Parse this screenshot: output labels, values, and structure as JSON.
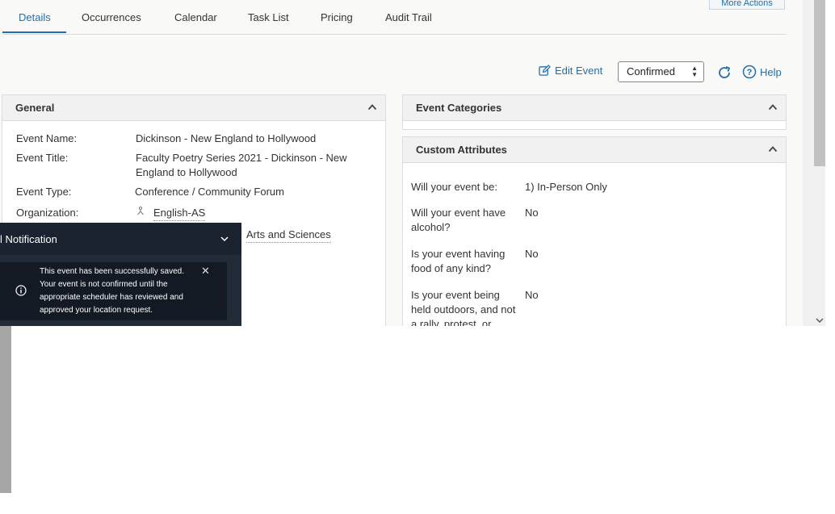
{
  "tabs": [
    {
      "label": "Details",
      "active": true
    },
    {
      "label": "Occurrences"
    },
    {
      "label": "Calendar"
    },
    {
      "label": "Task List"
    },
    {
      "label": "Pricing"
    },
    {
      "label": "Audit Trail"
    }
  ],
  "more_actions_label": "More Actions",
  "toolbar": {
    "edit_event_label": "Edit Event",
    "status_value": "Confirmed",
    "help_label": "Help"
  },
  "general": {
    "title": "General",
    "fields": {
      "event_name_label": "Event Name:",
      "event_name_value": "Dickinson - New England to Hollywood",
      "event_title_label": "Event Title:",
      "event_title_value": "Faculty Poetry Series 2021 - Dickinson - New England to Hollywood",
      "event_type_label": "Event Type:",
      "event_type_value": "Conference / Community Forum",
      "organization_label": "Organization:",
      "organization_value": "English-AS",
      "partial_value": "Arts and Sciences"
    }
  },
  "event_categories": {
    "title": "Event Categories"
  },
  "custom_attributes": {
    "title": "Custom Attributes",
    "rows": [
      {
        "question": "Will your event be:",
        "answer": "1) In-Person Only"
      },
      {
        "question": "Will your event have alcohol?",
        "answer": "No"
      },
      {
        "question": "Is your event having food of any kind?",
        "answer": "No"
      },
      {
        "question": "Is your event being held outdoors, and not a rally, protest, or",
        "answer": "No"
      }
    ]
  },
  "notification": {
    "title": "l Notification",
    "message": "This event has been successfully saved. Your event is not confirmed until the appropriate scheduler has reviewed and approved your location request.",
    "close_glyph": "✕"
  },
  "colors": {
    "accent": "#1f6fb2",
    "notification_bg": "#222b38"
  }
}
